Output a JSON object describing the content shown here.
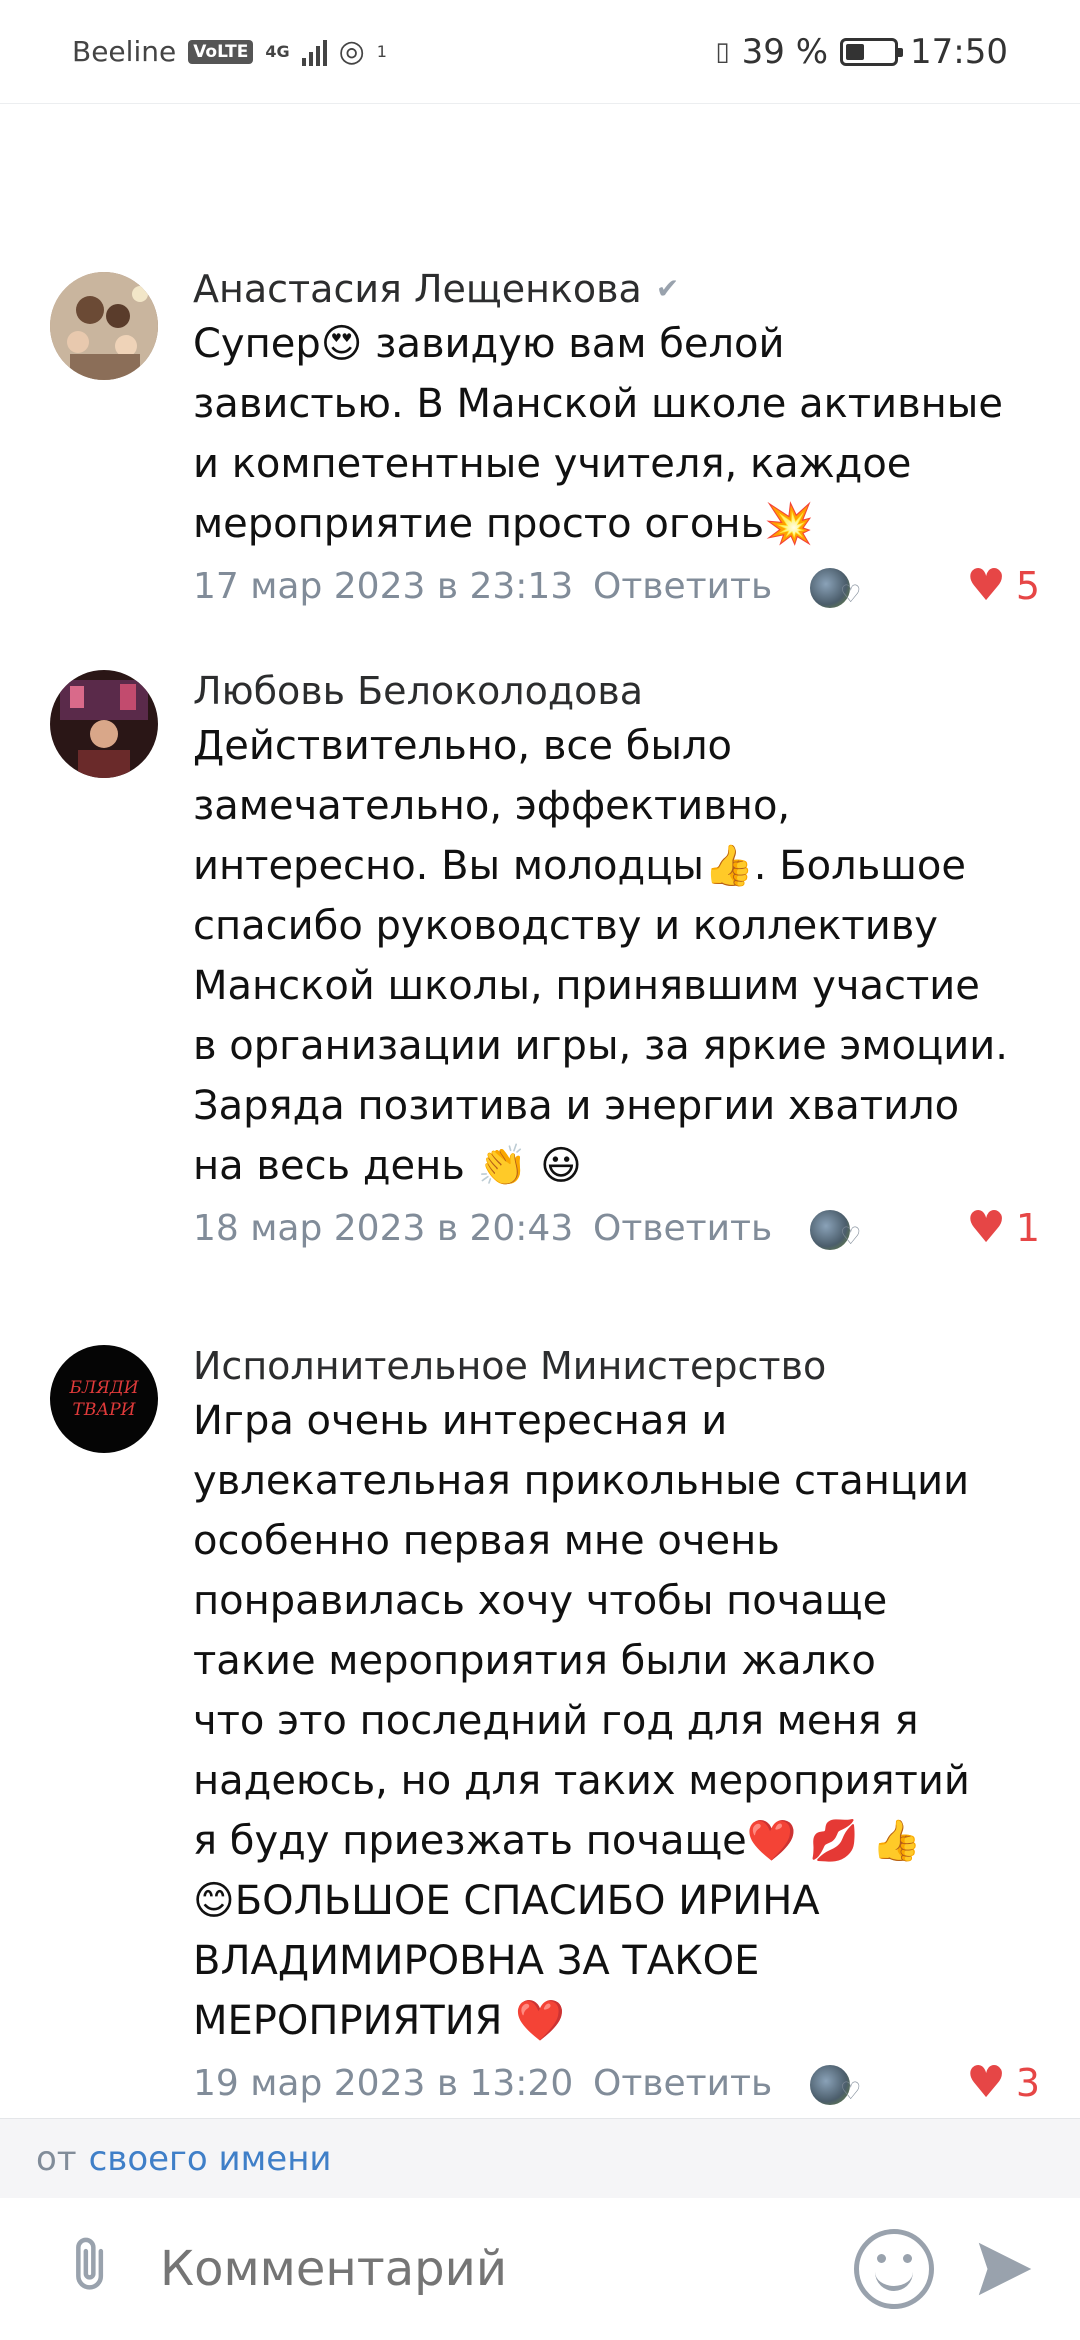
{
  "status_bar": {
    "carrier": "Beeline",
    "volte": "VoLTE",
    "network": "4G",
    "hotspot_count": "1",
    "battery_percent": "39 %",
    "battery_level": 0.39,
    "time": "17:50"
  },
  "comments": [
    {
      "author": "Анастасия Лещенкова",
      "verified": true,
      "text": "Супер😍 завидую вам белой\nзавистью. В Манской школе активные\nи компетентные учителя,  каждое\nмероприятие просто огонь💥",
      "date": "17 мар 2023 в 23:13",
      "reply_label": "Ответить",
      "likes": "5"
    },
    {
      "author": "Любовь Белоколодова",
      "verified": false,
      "text": "Действительно, все было\nзамечательно, эффективно,\nинтересно. Вы молодцы👍. Большое\nспасибо руководству и коллективу\nМанской школы, принявшим участие\nв организации игры, за яркие эмоции.\nЗаряда позитива и энергии хватило\nна весь день 👏 😃",
      "date": "18 мар 2023 в 20:43",
      "reply_label": "Ответить",
      "likes": "1"
    },
    {
      "author": "Исполнительное Министерство",
      "verified": false,
      "avatar_text": "БЛЯДИ\nТВАРИ",
      "text": "Игра очень интересная и\nувлекательная прикольные станции\nособенно первая мне очень\nпонравилась хочу чтобы почаще\nтакие мероприятия были жалко\nчто это последний год для меня я\nнадеюсь, но для таких мероприятий\nя буду приезжать почаще❤️ 💋 👍\n😊БОЛЬШОЕ СПАСИБО ИРИНА\nВЛАДИМИРОВНА ЗА ТАКОЕ\nМЕРОПРИЯТИЯ ❤️",
      "date": "19 мар 2023 в 13:20",
      "reply_label": "Ответить",
      "likes": "3"
    }
  ],
  "from_bar": {
    "prefix": "от",
    "link": "своего имени"
  },
  "composer": {
    "placeholder": "Комментарий"
  },
  "colors": {
    "like_red": "#e64646",
    "secondary_text": "#818c99",
    "link_blue": "#3f7fc8"
  }
}
